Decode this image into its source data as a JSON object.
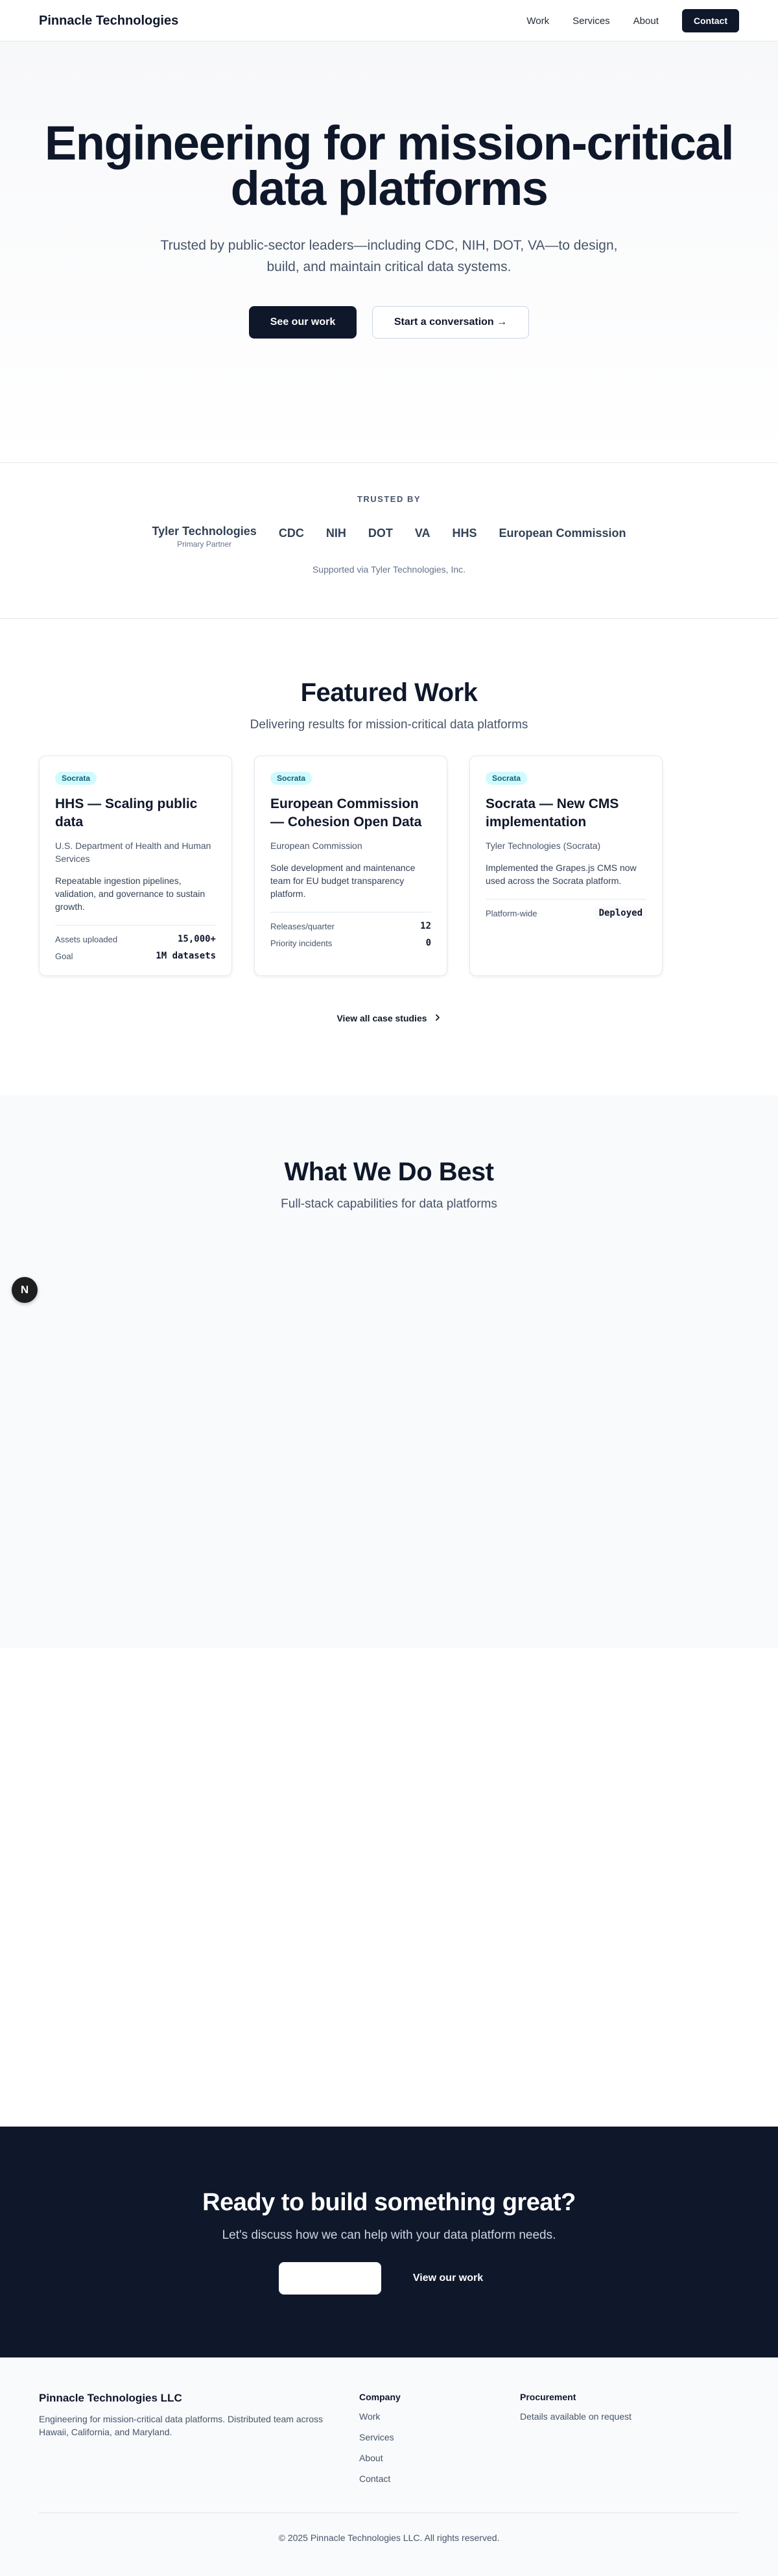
{
  "nav": {
    "brand": "Pinnacle Technologies",
    "links": [
      "Work",
      "Services",
      "About"
    ],
    "contact": "Contact"
  },
  "hero": {
    "title": "Engineering for mission-critical data platforms",
    "subtitle": "Trusted by public-sector leaders—including CDC, NIH, DOT, VA—to design, build, and maintain critical data systems.",
    "primary_cta": "See our work",
    "secondary_cta": "Start a conversation →"
  },
  "trusted": {
    "label": "TRUSTED BY",
    "primary_name": "Tyler Technologies",
    "primary_sub": "Primary Partner",
    "logos": [
      "CDC",
      "NIH",
      "DOT",
      "VA",
      "HHS",
      "European Commission"
    ],
    "note": "Supported via Tyler Technologies, Inc."
  },
  "featured": {
    "title": "Featured Work",
    "subtitle": "Delivering results for mission-critical data platforms",
    "cards": [
      {
        "tag": "Socrata",
        "title": "HHS — Scaling public data",
        "client": "U.S. Department of Health and Human Services",
        "desc": "Repeatable ingestion pipelines, validation, and governance to sustain growth.",
        "metrics": [
          {
            "k": "Assets uploaded",
            "v": "15,000+"
          },
          {
            "k": "Goal",
            "v": "1M datasets"
          }
        ]
      },
      {
        "tag": "Socrata",
        "title": "European Commission — Cohesion Open Data",
        "client": "European Commission",
        "desc": "Sole development and maintenance team for EU budget transparency platform.",
        "metrics": [
          {
            "k": "Releases/quarter",
            "v": "12"
          },
          {
            "k": "Priority incidents",
            "v": "0"
          }
        ]
      },
      {
        "tag": "Socrata",
        "title": "Socrata — New CMS implementation",
        "client": "Tyler Technologies (Socrata)",
        "desc": "Implemented the Grapes.js CMS now used across the Socrata platform.",
        "metrics": [
          {
            "k": "Platform-wide",
            "v": "Deployed"
          }
        ]
      }
    ],
    "view_all": "View all case studies",
    "view_all_icon": "chevron-right-icon"
  },
  "services": {
    "title": "What We Do Best",
    "subtitle": "Full-stack capabilities for data platforms"
  },
  "fab": {
    "label": "N"
  },
  "cta": {
    "title": "Ready to build something great?",
    "subtitle": "Let's discuss how we can help with your data platform needs.",
    "primary": "",
    "secondary": "View our work"
  },
  "footer": {
    "brand": "Pinnacle Technologies LLC",
    "desc": "Engineering for mission-critical data platforms. Distributed team across Hawaii, California, and Maryland.",
    "company_head": "Company",
    "company_links": [
      "Work",
      "Services",
      "About",
      "Contact"
    ],
    "procurement_head": "Procurement",
    "procurement_text": "Details available on request",
    "copyright": "© 2025 Pinnacle Technologies LLC. All rights reserved."
  }
}
